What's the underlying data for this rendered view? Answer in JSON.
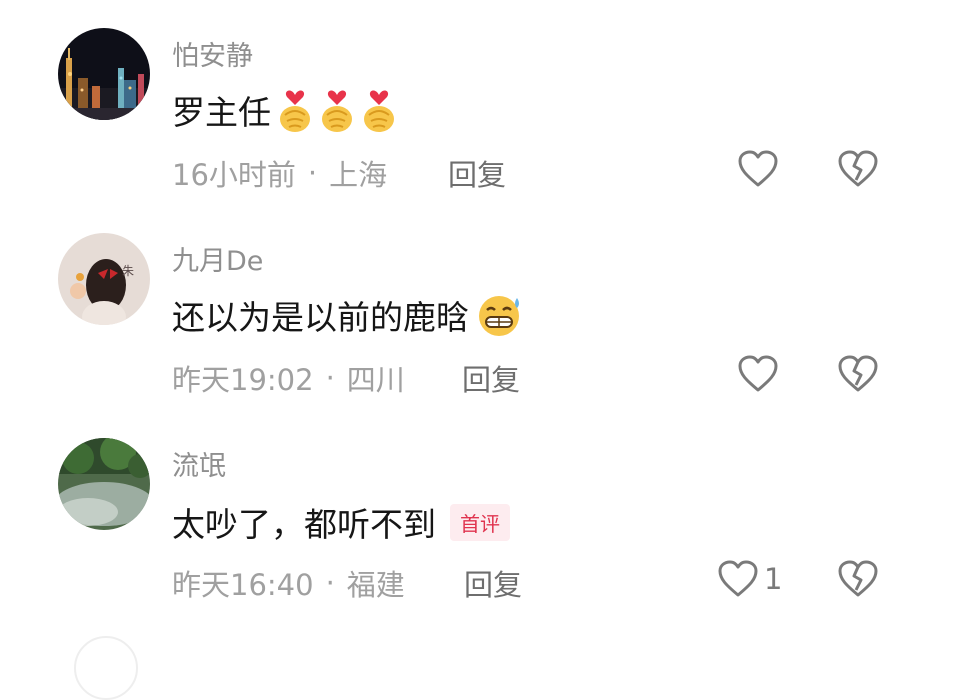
{
  "comments": [
    {
      "username": "怕安静",
      "text": "罗主任",
      "time": "16小时前",
      "location": "上海",
      "reply_label": "回复",
      "like_count": "",
      "emojis": [
        "finger-heart",
        "finger-heart",
        "finger-heart"
      ]
    },
    {
      "username": "九月De",
      "text": "还以为是以前的鹿晗",
      "time": "昨天19:02",
      "location": "四川",
      "reply_label": "回复",
      "like_count": "",
      "emojis": [
        "grinning-sweat"
      ]
    },
    {
      "username": "流氓",
      "text": "太吵了，都听不到",
      "badge": "首评",
      "time": "昨天16:40",
      "location": "福建",
      "reply_label": "回复",
      "like_count": "1",
      "emojis": []
    }
  ],
  "separator": "·",
  "colors": {
    "username": "#8f8f8f",
    "text": "#161616",
    "meta": "#a0a0a0",
    "badge_text": "#e0344f",
    "badge_bg": "#fdecef",
    "icon": "#7a7a7a"
  },
  "icons": {
    "like": "heart-outline-icon",
    "dislike": "broken-heart-icon"
  }
}
